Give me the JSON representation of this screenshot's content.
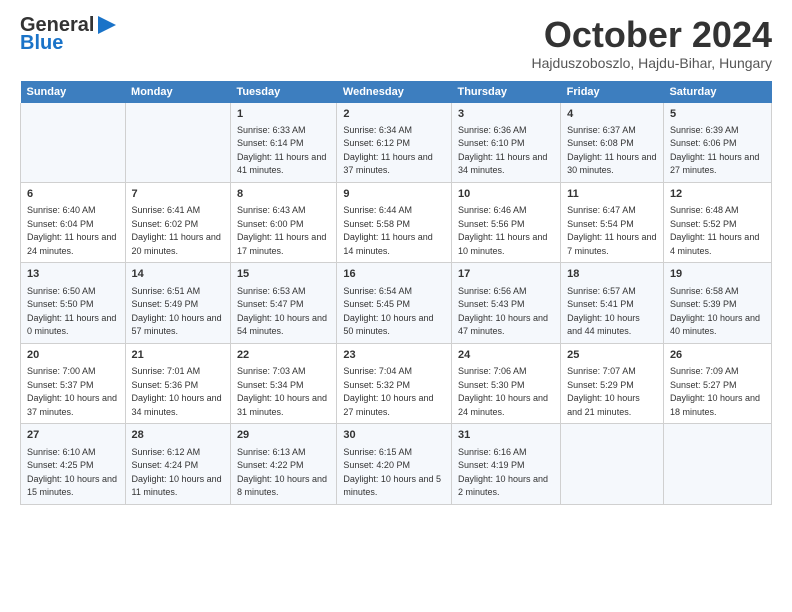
{
  "logo": {
    "general": "General",
    "blue": "Blue"
  },
  "header": {
    "month": "October 2024",
    "location": "Hajduszoboszlo, Hajdu-Bihar, Hungary"
  },
  "weekdays": [
    "Sunday",
    "Monday",
    "Tuesday",
    "Wednesday",
    "Thursday",
    "Friday",
    "Saturday"
  ],
  "weeks": [
    [
      {
        "day": "",
        "info": ""
      },
      {
        "day": "",
        "info": ""
      },
      {
        "day": "1",
        "info": "Sunrise: 6:33 AM\nSunset: 6:14 PM\nDaylight: 11 hours and 41 minutes."
      },
      {
        "day": "2",
        "info": "Sunrise: 6:34 AM\nSunset: 6:12 PM\nDaylight: 11 hours and 37 minutes."
      },
      {
        "day": "3",
        "info": "Sunrise: 6:36 AM\nSunset: 6:10 PM\nDaylight: 11 hours and 34 minutes."
      },
      {
        "day": "4",
        "info": "Sunrise: 6:37 AM\nSunset: 6:08 PM\nDaylight: 11 hours and 30 minutes."
      },
      {
        "day": "5",
        "info": "Sunrise: 6:39 AM\nSunset: 6:06 PM\nDaylight: 11 hours and 27 minutes."
      }
    ],
    [
      {
        "day": "6",
        "info": "Sunrise: 6:40 AM\nSunset: 6:04 PM\nDaylight: 11 hours and 24 minutes."
      },
      {
        "day": "7",
        "info": "Sunrise: 6:41 AM\nSunset: 6:02 PM\nDaylight: 11 hours and 20 minutes."
      },
      {
        "day": "8",
        "info": "Sunrise: 6:43 AM\nSunset: 6:00 PM\nDaylight: 11 hours and 17 minutes."
      },
      {
        "day": "9",
        "info": "Sunrise: 6:44 AM\nSunset: 5:58 PM\nDaylight: 11 hours and 14 minutes."
      },
      {
        "day": "10",
        "info": "Sunrise: 6:46 AM\nSunset: 5:56 PM\nDaylight: 11 hours and 10 minutes."
      },
      {
        "day": "11",
        "info": "Sunrise: 6:47 AM\nSunset: 5:54 PM\nDaylight: 11 hours and 7 minutes."
      },
      {
        "day": "12",
        "info": "Sunrise: 6:48 AM\nSunset: 5:52 PM\nDaylight: 11 hours and 4 minutes."
      }
    ],
    [
      {
        "day": "13",
        "info": "Sunrise: 6:50 AM\nSunset: 5:50 PM\nDaylight: 11 hours and 0 minutes."
      },
      {
        "day": "14",
        "info": "Sunrise: 6:51 AM\nSunset: 5:49 PM\nDaylight: 10 hours and 57 minutes."
      },
      {
        "day": "15",
        "info": "Sunrise: 6:53 AM\nSunset: 5:47 PM\nDaylight: 10 hours and 54 minutes."
      },
      {
        "day": "16",
        "info": "Sunrise: 6:54 AM\nSunset: 5:45 PM\nDaylight: 10 hours and 50 minutes."
      },
      {
        "day": "17",
        "info": "Sunrise: 6:56 AM\nSunset: 5:43 PM\nDaylight: 10 hours and 47 minutes."
      },
      {
        "day": "18",
        "info": "Sunrise: 6:57 AM\nSunset: 5:41 PM\nDaylight: 10 hours and 44 minutes."
      },
      {
        "day": "19",
        "info": "Sunrise: 6:58 AM\nSunset: 5:39 PM\nDaylight: 10 hours and 40 minutes."
      }
    ],
    [
      {
        "day": "20",
        "info": "Sunrise: 7:00 AM\nSunset: 5:37 PM\nDaylight: 10 hours and 37 minutes."
      },
      {
        "day": "21",
        "info": "Sunrise: 7:01 AM\nSunset: 5:36 PM\nDaylight: 10 hours and 34 minutes."
      },
      {
        "day": "22",
        "info": "Sunrise: 7:03 AM\nSunset: 5:34 PM\nDaylight: 10 hours and 31 minutes."
      },
      {
        "day": "23",
        "info": "Sunrise: 7:04 AM\nSunset: 5:32 PM\nDaylight: 10 hours and 27 minutes."
      },
      {
        "day": "24",
        "info": "Sunrise: 7:06 AM\nSunset: 5:30 PM\nDaylight: 10 hours and 24 minutes."
      },
      {
        "day": "25",
        "info": "Sunrise: 7:07 AM\nSunset: 5:29 PM\nDaylight: 10 hours and 21 minutes."
      },
      {
        "day": "26",
        "info": "Sunrise: 7:09 AM\nSunset: 5:27 PM\nDaylight: 10 hours and 18 minutes."
      }
    ],
    [
      {
        "day": "27",
        "info": "Sunrise: 6:10 AM\nSunset: 4:25 PM\nDaylight: 10 hours and 15 minutes."
      },
      {
        "day": "28",
        "info": "Sunrise: 6:12 AM\nSunset: 4:24 PM\nDaylight: 10 hours and 11 minutes."
      },
      {
        "day": "29",
        "info": "Sunrise: 6:13 AM\nSunset: 4:22 PM\nDaylight: 10 hours and 8 minutes."
      },
      {
        "day": "30",
        "info": "Sunrise: 6:15 AM\nSunset: 4:20 PM\nDaylight: 10 hours and 5 minutes."
      },
      {
        "day": "31",
        "info": "Sunrise: 6:16 AM\nSunset: 4:19 PM\nDaylight: 10 hours and 2 minutes."
      },
      {
        "day": "",
        "info": ""
      },
      {
        "day": "",
        "info": ""
      }
    ]
  ]
}
